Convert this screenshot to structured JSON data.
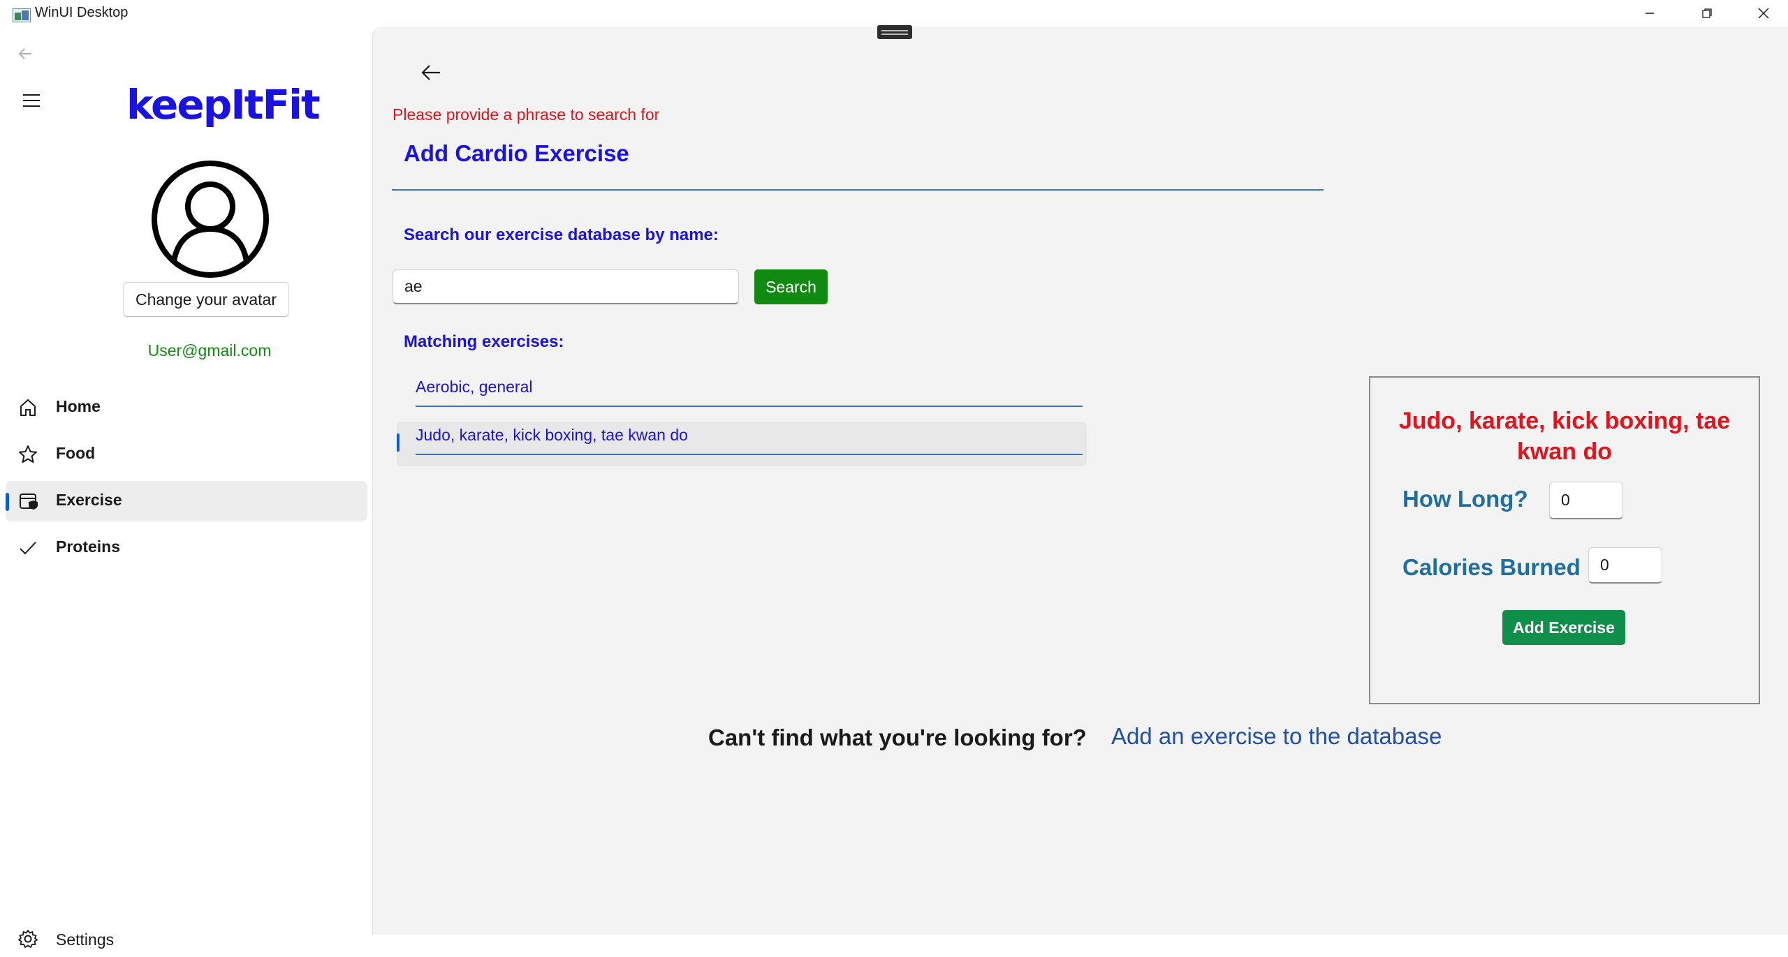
{
  "window": {
    "title": "WinUI Desktop"
  },
  "sidebar": {
    "logo": "keepItFit",
    "avatar_button": "Change your avatar",
    "email": "User@gmail.com",
    "items": [
      {
        "label": "Home",
        "icon": "home-icon"
      },
      {
        "label": "Food",
        "icon": "star-icon"
      },
      {
        "label": "Exercise",
        "icon": "exercise-icon",
        "selected": true
      },
      {
        "label": "Proteins",
        "icon": "checkmark-icon"
      }
    ],
    "settings_label": "Settings"
  },
  "main": {
    "error_message": "Please provide a phrase to search for",
    "title": "Add Cardio Exercise",
    "search_label": "Search our exercise database by name:",
    "search_value": "ae",
    "search_button": "Search",
    "matching_label": "Matching exercises:",
    "results": [
      "Aerobic, general",
      "Judo, karate, kick boxing, tae kwan do"
    ],
    "selected_result_index": 1,
    "detail": {
      "title": "Judo, karate, kick boxing, tae kwan do",
      "how_long_label": "How Long?",
      "how_long_value": "0",
      "calories_label": "Calories Burned",
      "calories_value": "0",
      "add_button": "Add Exercise"
    },
    "cant_find_text": "Can't find what you're looking for?",
    "add_link": "Add an exercise to the database"
  },
  "colors": {
    "accent_blue": "#1a12e0",
    "error_red": "#e5121c",
    "success_green": "#108a10",
    "field_label_blue": "#1e6fa0",
    "add_button_green": "#0e8f4a",
    "selection_indicator": "#0a5ec8"
  }
}
